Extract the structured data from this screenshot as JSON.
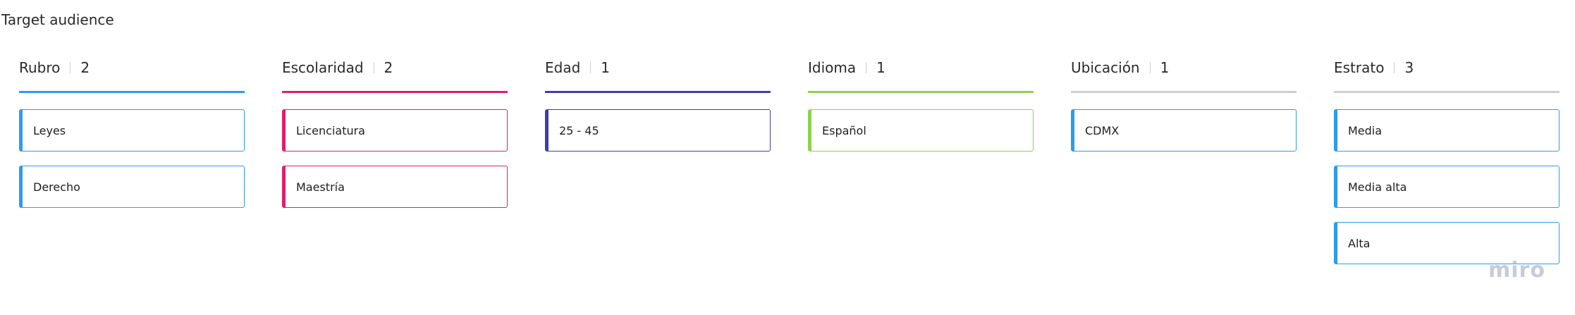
{
  "board": {
    "title": "Target audience",
    "watermark": "miro"
  },
  "columns": [
    {
      "title": "Rubro",
      "count": "2",
      "color": "#2d9bf0",
      "cards": [
        "Leyes",
        "Derecho"
      ]
    },
    {
      "title": "Escolaridad",
      "count": "2",
      "color": "#e01e6b",
      "cards": [
        "Licenciatura",
        "Maestría"
      ]
    },
    {
      "title": "Edad",
      "count": "1",
      "color": "#3f3fa6",
      "cards": [
        "25 - 45"
      ]
    },
    {
      "title": "Idioma",
      "count": "1",
      "color": "#8fd14f",
      "cards": [
        "Español"
      ]
    },
    {
      "title": "Ubicación",
      "count": "1",
      "color": "#cfcfcf",
      "cards": [
        "CDMX"
      ]
    },
    {
      "title": "Estrato",
      "count": "3",
      "color": "#cfcfcf",
      "cards": [
        "Media",
        "Media alta",
        "Alta"
      ]
    }
  ],
  "card_accent": {
    "Rubro": "#2d9bf0",
    "Escolaridad": "#e01e6b",
    "Edad": "#3f3fa6",
    "Idioma": "#8fd14f",
    "Ubicación": "#2d9bf0",
    "Estrato": "#2d9bf0"
  }
}
